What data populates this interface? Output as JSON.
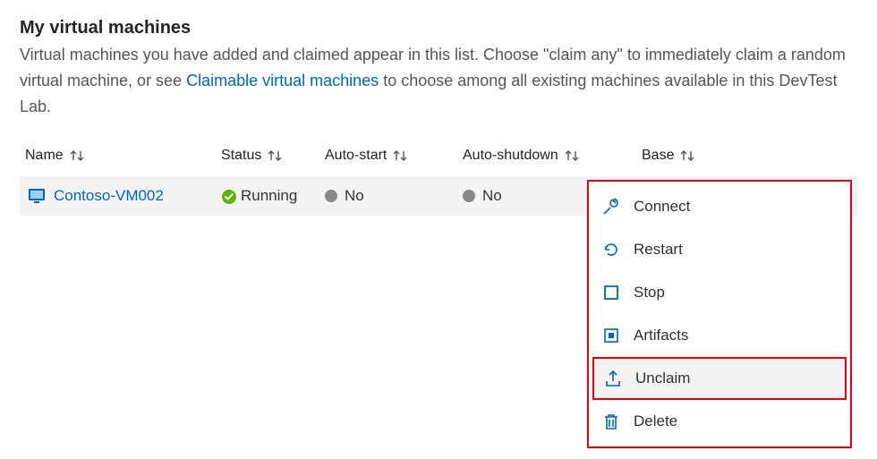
{
  "title": "My virtual machines",
  "description_pre": "Virtual machines you have added and claimed appear in this list. Choose \"claim any\" to immediately claim a random virtual machine, or see ",
  "description_link": "Claimable virtual machines",
  "description_post": " to choose among all existing machines available in this DevTest Lab.",
  "columns": {
    "name": "Name",
    "status": "Status",
    "autostart": "Auto-start",
    "autoshutdown": "Auto-shutdown",
    "base": "Base"
  },
  "row": {
    "name": "Contoso-VM002",
    "status": "Running",
    "autostart": "No",
    "autoshutdown": "No",
    "base": ""
  },
  "menu": {
    "connect": "Connect",
    "restart": "Restart",
    "stop": "Stop",
    "artifacts": "Artifacts",
    "unclaim": "Unclaim",
    "delete": "Delete"
  }
}
